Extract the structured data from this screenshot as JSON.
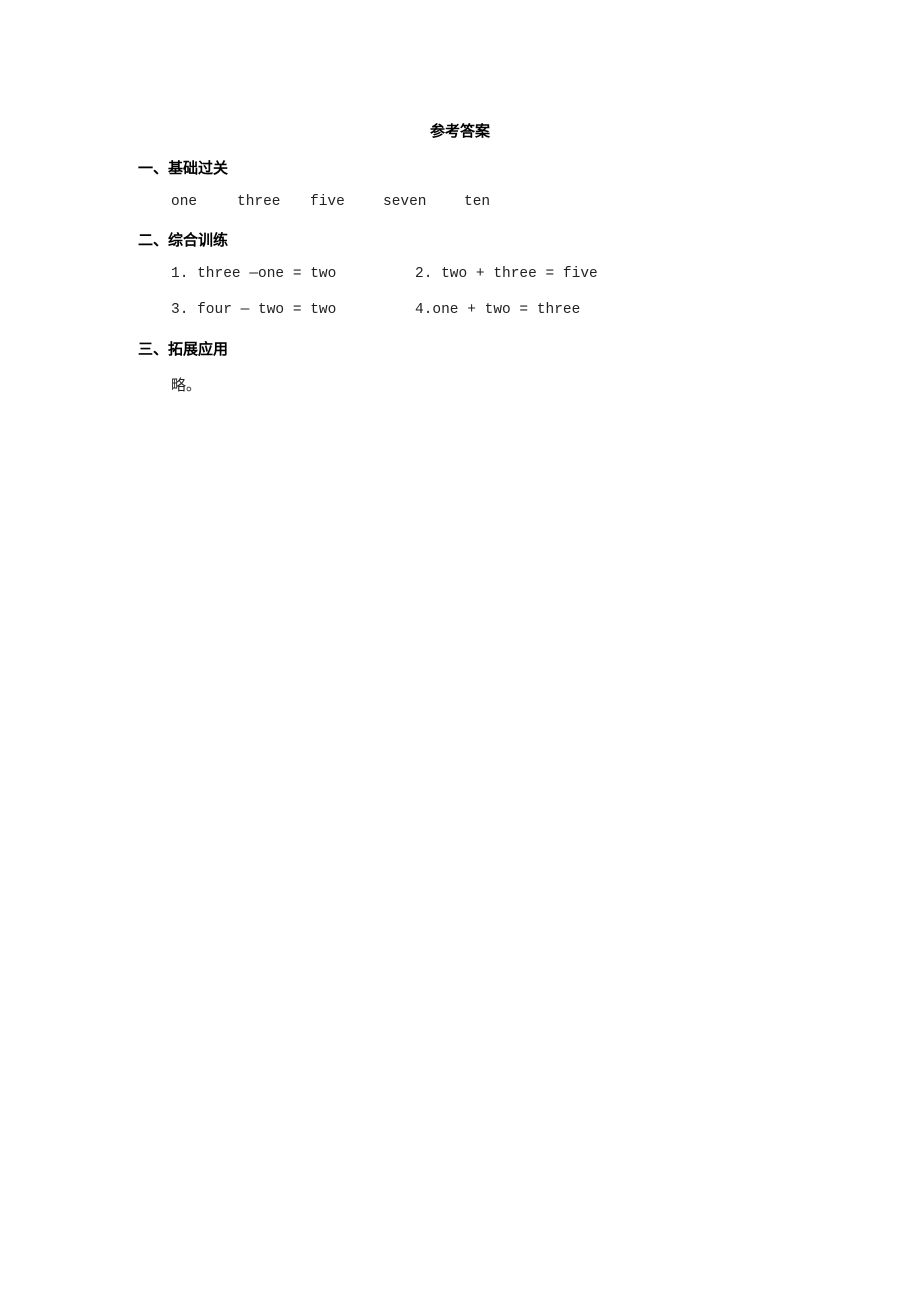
{
  "title": "参考答案",
  "sections": [
    {
      "heading": "一、基础过关",
      "words": [
        "one",
        "three",
        "five",
        "seven",
        "ten"
      ]
    },
    {
      "heading": "二、综合训练",
      "items": [
        "1. three —one = two",
        "2. two + three = five",
        "3. four — two = two",
        "4.one + two = three"
      ]
    },
    {
      "heading": "三、拓展应用",
      "text": "略。"
    }
  ]
}
